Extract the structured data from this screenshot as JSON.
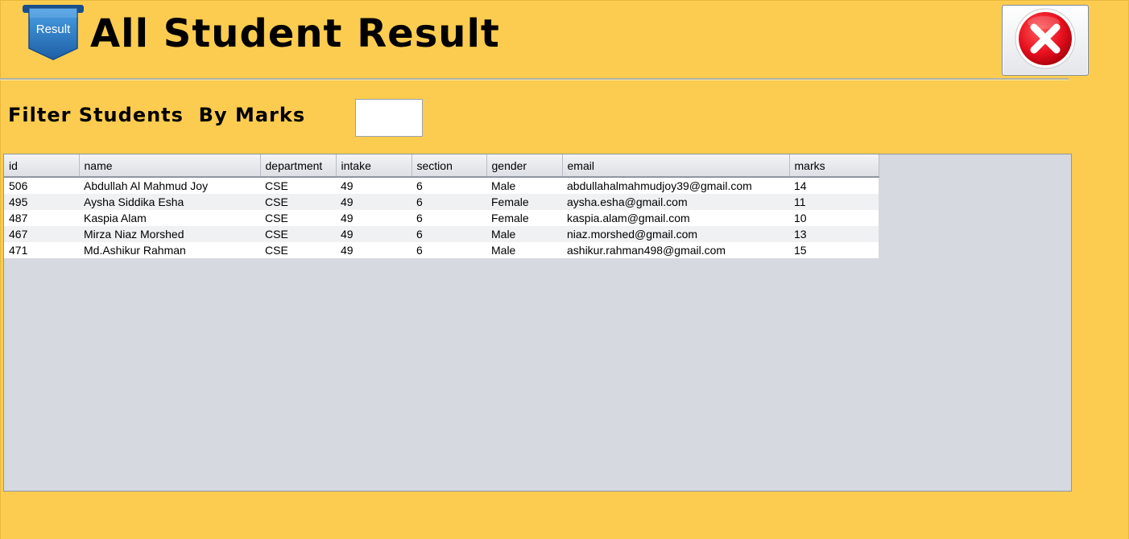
{
  "header": {
    "title": "All Student Result",
    "logo_text": "Result",
    "close_icon": "close-icon"
  },
  "filter": {
    "label": "Filter Students  By Marks",
    "value": "",
    "placeholder": ""
  },
  "table": {
    "columns": [
      "id",
      "name",
      "department",
      "intake",
      "section",
      "gender",
      "email",
      "marks"
    ],
    "rows": [
      [
        "506",
        "Abdullah Al Mahmud Joy",
        "CSE",
        "49",
        "6",
        "Male",
        "abdullahalmahmudjoy39@gmail.com",
        "14"
      ],
      [
        "495",
        "Aysha Siddika Esha",
        "CSE",
        "49",
        "6",
        "Female",
        "aysha.esha@gmail.com",
        "11"
      ],
      [
        "487",
        "Kaspia Alam",
        "CSE",
        "49",
        "6",
        "Female",
        "kaspia.alam@gmail.com",
        "10"
      ],
      [
        "467",
        "Mirza Niaz Morshed",
        "CSE",
        "49",
        "6",
        "Male",
        "niaz.morshed@gmail.com",
        "13"
      ],
      [
        "471",
        "Md.Ashikur Rahman",
        "CSE",
        "49",
        "6",
        "Male",
        "ashikur.rahman498@gmail.com",
        "15"
      ]
    ]
  },
  "colors": {
    "background": "#fccc50",
    "close_red": "#e8101e",
    "logo_blue": "#2f7fc8",
    "table_empty_area": "#d6d9e0"
  }
}
